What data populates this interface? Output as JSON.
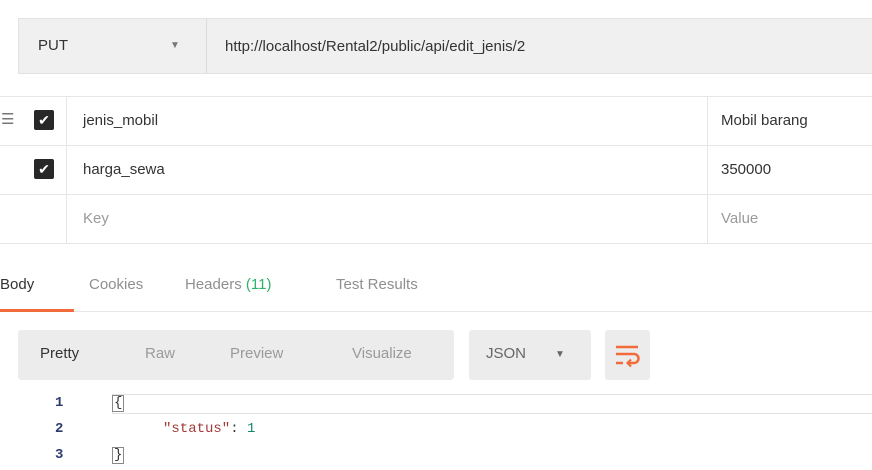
{
  "request": {
    "method": "PUT",
    "url": "http://localhost/Rental2/public/api/edit_jenis/2"
  },
  "params": {
    "rows": [
      {
        "key": "jenis_mobil",
        "value": "Mobil barang",
        "checked": true
      },
      {
        "key": "harga_sewa",
        "value": "350000",
        "checked": true
      }
    ],
    "new_row": {
      "key_placeholder": "Key",
      "value_placeholder": "Value"
    }
  },
  "response_tabs": {
    "body": "Body",
    "cookies": "Cookies",
    "headers_label": "Headers",
    "headers_count": "(11)",
    "test_results": "Test Results",
    "active": "Body"
  },
  "format_bar": {
    "modes": [
      "Pretty",
      "Raw",
      "Preview",
      "Visualize"
    ],
    "active_mode": "Pretty",
    "language": "JSON"
  },
  "response_body": {
    "line_numbers": [
      "1",
      "2",
      "3"
    ],
    "open_brace": "{",
    "status_key": "\"status\"",
    "colon": ": ",
    "status_value": "1",
    "close_brace": "}"
  },
  "colors": {
    "accent_tab_underline": "#f26b3a",
    "headers_count": "#2db36a",
    "wrap_icon": "#f26b3a",
    "json_key": "#a33a3a",
    "json_number": "#16866c"
  },
  "icons": {
    "drag_handle": "drag-handle-icon",
    "checkbox": "checkmark-icon",
    "method_dropdown": "chevron-down-icon",
    "language_dropdown": "chevron-down-icon",
    "wrap_lines": "wrap-lines-icon"
  }
}
